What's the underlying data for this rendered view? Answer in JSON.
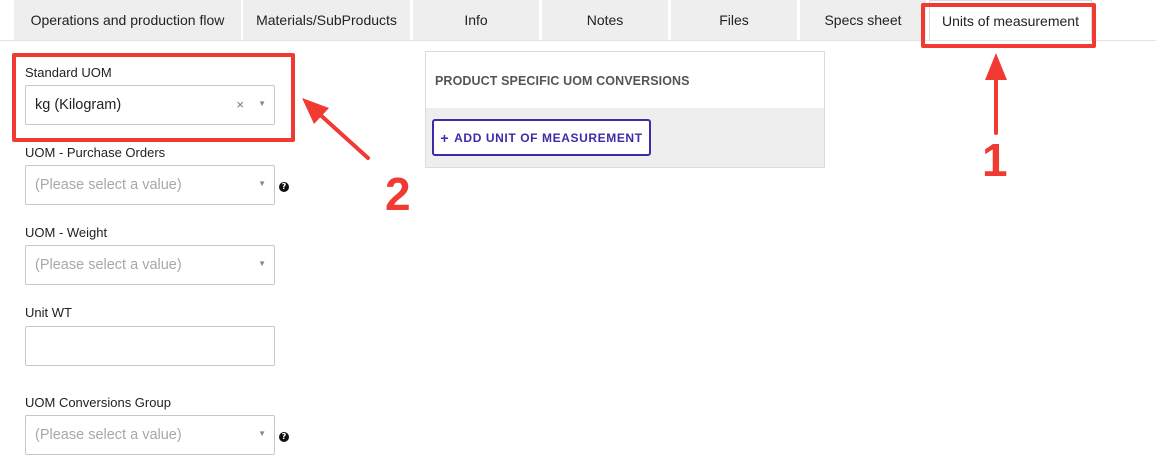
{
  "tabs": [
    {
      "label": "Operations and production flow",
      "active": false
    },
    {
      "label": "Materials/SubProducts",
      "active": false
    },
    {
      "label": "Info",
      "active": false
    },
    {
      "label": "Notes",
      "active": false
    },
    {
      "label": "Files",
      "active": false
    },
    {
      "label": "Specs sheet",
      "active": false
    },
    {
      "label": "Units of measurement",
      "active": true
    }
  ],
  "form": {
    "standard_uom": {
      "label": "Standard UOM",
      "value": "kg (Kilogram)",
      "clear": "×",
      "caret": "▼"
    },
    "uom_purchase_orders": {
      "label": "UOM - Purchase Orders",
      "placeholder": "(Please select a value)",
      "caret": "▼",
      "help": "?"
    },
    "uom_weight": {
      "label": "UOM - Weight",
      "placeholder": "(Please select a value)",
      "caret": "▼"
    },
    "unit_wt": {
      "label": "Unit WT",
      "value": ""
    },
    "uom_conversions_group": {
      "label": "UOM Conversions Group",
      "placeholder": "(Please select a value)",
      "caret": "▼",
      "help": "?"
    }
  },
  "panel": {
    "title": "PRODUCT SPECIFIC UOM CONVERSIONS",
    "add_button": {
      "icon": "plus-icon",
      "plus": "+",
      "label": "ADD UNIT OF MEASUREMENT",
      "color": "#3f2aa8"
    }
  },
  "annotations": {
    "color": "#f03a32",
    "step1": "1",
    "step2": "2"
  }
}
